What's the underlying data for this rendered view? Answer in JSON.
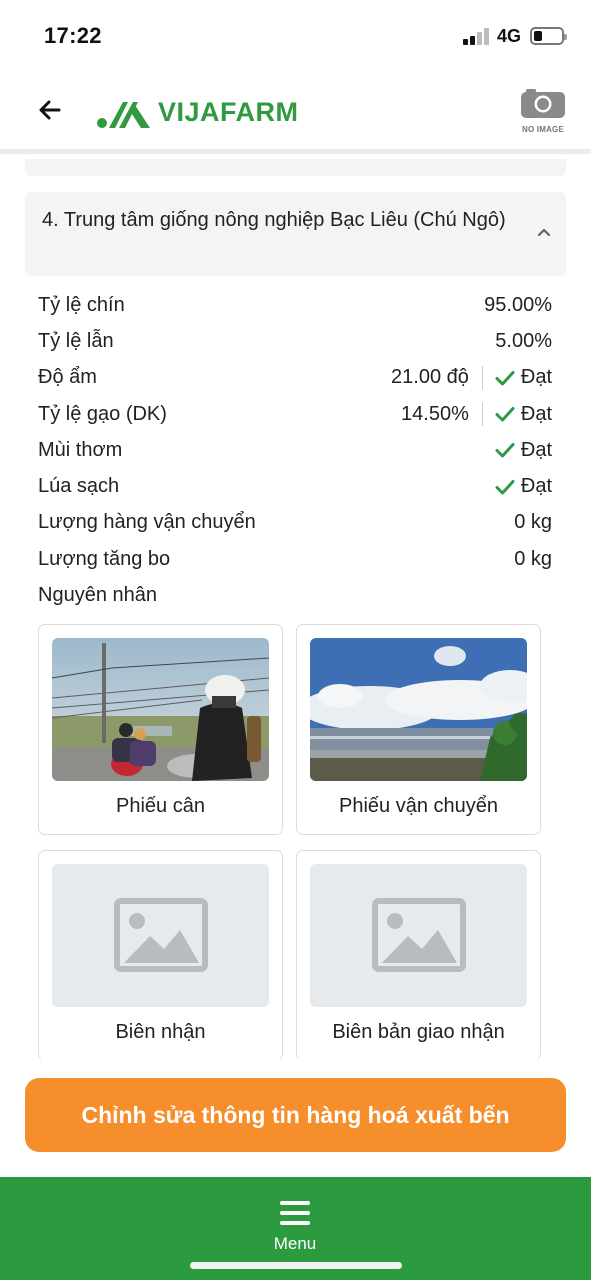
{
  "status_bar": {
    "time": "17:22",
    "network": "4G"
  },
  "header": {
    "logo_text": "VIJAFARM",
    "no_image_label": "NO IMAGE"
  },
  "section": {
    "title": "4. Trung tâm giống nông nghiệp Bạc Liêu (Chú Ngô)",
    "rows": [
      {
        "label": "Tỷ lệ chín",
        "value": "95.00%"
      },
      {
        "label": "Tỷ lệ lẫn",
        "value": "5.00%"
      },
      {
        "label": "Độ ẩm",
        "value": "21.00 độ",
        "status": "Đạt"
      },
      {
        "label": "Tỷ lệ gạo (DK)",
        "value": "14.50%",
        "status": "Đạt"
      },
      {
        "label": "Mùi thơm",
        "status": "Đạt"
      },
      {
        "label": "Lúa sạch",
        "status": "Đạt"
      },
      {
        "label": "Lượng hàng vận chuyển",
        "value": "0 kg"
      },
      {
        "label": "Lượng tăng bo",
        "value": "0 kg"
      },
      {
        "label": "Nguyên nhân"
      }
    ],
    "photos": [
      {
        "caption": "Phiếu cân"
      },
      {
        "caption": "Phiếu vận chuyển"
      },
      {
        "caption": "Biên nhận"
      },
      {
        "caption": "Biên bản giao nhận"
      }
    ]
  },
  "actions": {
    "edit_label": "Chỉnh sửa thông tin hàng hoá xuất bến"
  },
  "bottom_nav": {
    "menu_label": "Menu"
  },
  "colors": {
    "brand_green": "#2f9a3f",
    "nav_green": "#2c9a3f",
    "action_orange": "#f58e2b",
    "check_green": "#2e9a45"
  }
}
